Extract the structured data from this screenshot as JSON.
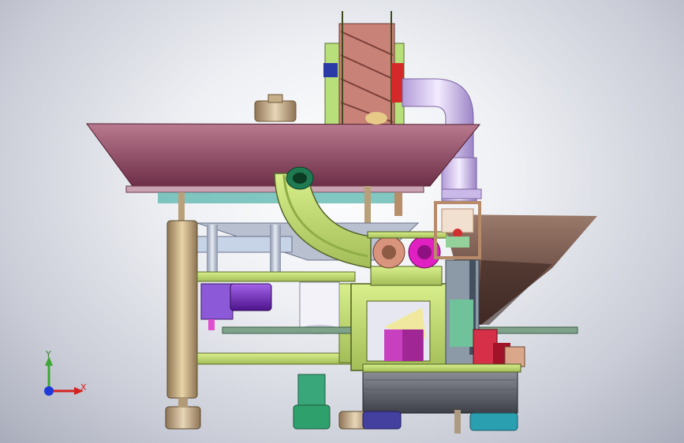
{
  "view": {
    "name": "cad-viewport",
    "background_center": "#ffffff",
    "background_edge": "#a9adbb"
  },
  "triad": {
    "y_label": "Y",
    "x_label": "X",
    "y_color": "#3fa535",
    "x_color": "#d42222",
    "z_color": "#1f3ad8"
  },
  "colors": {
    "hopper": "#8e4a63",
    "frame": "#c9e27a",
    "tube": "#d8c6f0",
    "column": "#c4ac82",
    "motor": "#7a27c8",
    "roller_magenta": "#e020c0",
    "roller_tan": "#d8947c",
    "feet": "#2ea06b"
  }
}
